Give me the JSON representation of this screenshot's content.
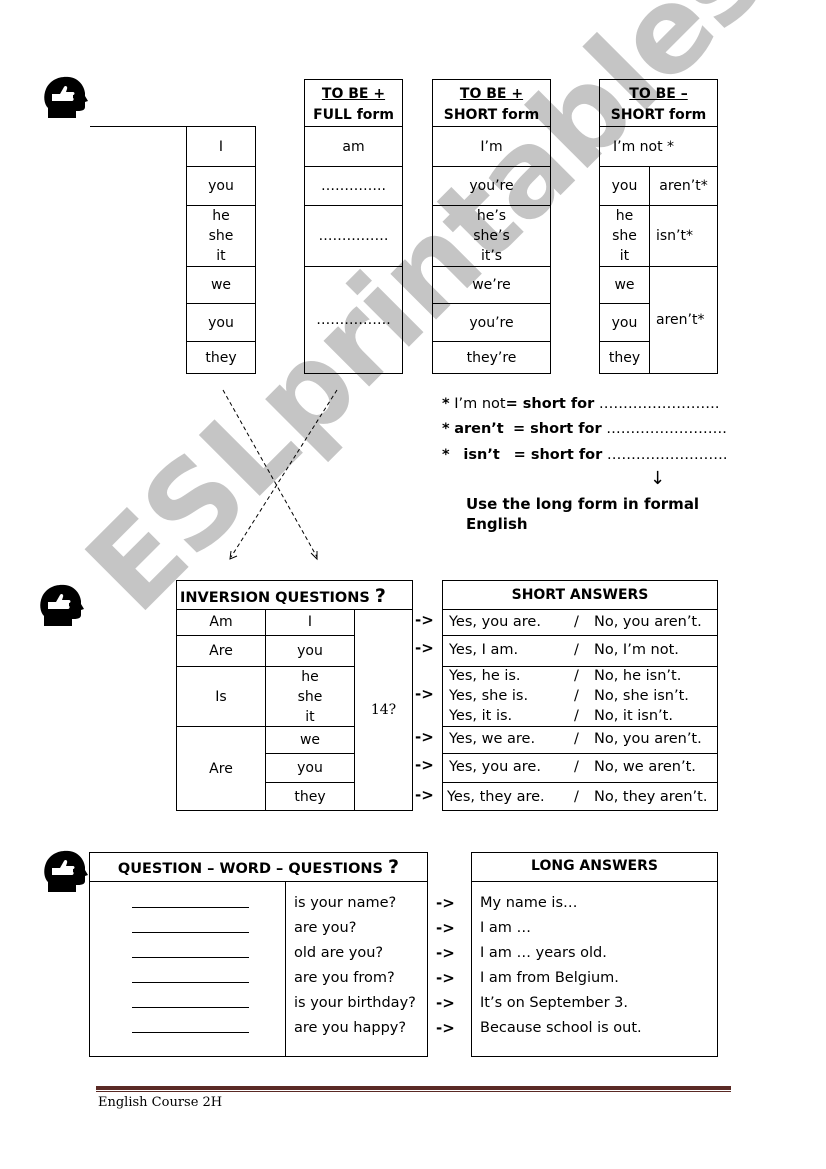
{
  "section1": {
    "pronouns": [
      "I",
      "you",
      "he\nshe\nit",
      "we",
      "you",
      "they"
    ],
    "full_form": {
      "header_line1": "TO BE +",
      "header_line2": "FULL form",
      "cells": [
        "am",
        "…………..",
        "……………",
        "……………."
      ]
    },
    "short_form": {
      "header_line1": "TO BE +",
      "header_line2": "SHORT form",
      "cells": [
        "I’m",
        "you’re",
        "he’s\nshe’s\nit’s",
        "we’re",
        "you’re",
        "they’re"
      ]
    },
    "negative_short": {
      "header_line1": "TO BE –",
      "header_line2": "SHORT form",
      "im_not": "I’m not *",
      "pronouns": [
        "you",
        "he\nshe\nit",
        "we",
        "you",
        "they"
      ],
      "verbs": [
        "aren’t*",
        "isn’t*",
        "aren’t*"
      ]
    }
  },
  "notes": {
    "lines": [
      {
        "star": "*",
        "term": "I’m not",
        "eq": "= short for",
        "blank": "……………………."
      },
      {
        "star": "*",
        "term": "aren’t",
        "eq": "= short for",
        "blank": "……………………."
      },
      {
        "star": "*",
        "term": "isn’t",
        "eq": "= short for",
        "blank": "……………………."
      }
    ],
    "down_arrow": "↓",
    "remark_line1": "Use the long form in formal",
    "remark_line2": "English"
  },
  "inversion": {
    "title": "INVERSION QUESTIONS",
    "qmark": "?",
    "verbs": [
      "Am",
      "Are",
      "Is",
      "Are"
    ],
    "subjects": [
      "I",
      "you",
      "he\nshe\nit",
      "we",
      "you",
      "they"
    ],
    "age": "14?"
  },
  "short_answers": {
    "title": "SHORT ANSWERS",
    "arrow": "->",
    "slash": "/",
    "rows": [
      {
        "yes": [
          "Yes, you are."
        ],
        "no": [
          "No, you aren’t."
        ]
      },
      {
        "yes": [
          "Yes, I am."
        ],
        "no": [
          "No, I’m not."
        ]
      },
      {
        "yes": [
          "Yes, he is.",
          "Yes, she is.",
          "Yes, it is."
        ],
        "no": [
          "No, he isn’t.",
          "No, she isn’t.",
          "No, it isn’t."
        ]
      },
      {
        "yes": [
          "Yes, we are."
        ],
        "no": [
          "No, you aren’t."
        ]
      },
      {
        "yes": [
          "Yes, you are."
        ],
        "no": [
          "No, we aren’t."
        ]
      },
      {
        "yes": [
          "Yes, they are."
        ],
        "no": [
          "No, they aren’t."
        ]
      }
    ]
  },
  "qw_questions": {
    "title": "QUESTION – WORD – QUESTIONS",
    "qmark": "?",
    "items": [
      "is your name?",
      "are you?",
      "old are you?",
      "are you from?",
      "is your birthday?",
      "are you happy?"
    ]
  },
  "long_answers": {
    "title": "LONG ANSWERS",
    "arrow": "->",
    "items": [
      "My name is…",
      "I am …",
      "I am … years old.",
      "I am from Belgium.",
      "It’s on September 3.",
      "Because school is out."
    ]
  },
  "watermark": "ESLprintables.com",
  "footer": {
    "text": "English Course 2H",
    "rule_color": "#5a2a25"
  }
}
